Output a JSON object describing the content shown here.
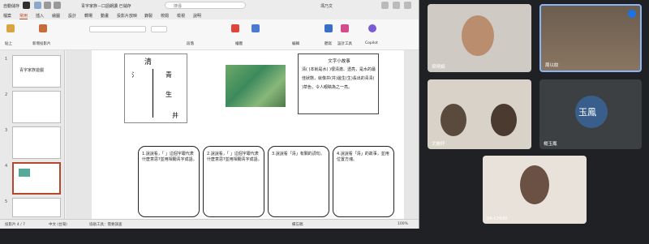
{
  "titlebar": {
    "autosave": "自動儲存",
    "doc_title": "青字家族－口語朗讀 已儲存",
    "search": "搜尋",
    "user": "馮乃文",
    "colors": {
      "brand": "#b7472a"
    }
  },
  "menubar": {
    "items": [
      "檔案",
      "常用",
      "插入",
      "繪圖",
      "設計",
      "轉場",
      "動畫",
      "投影片放映",
      "錄製",
      "校閱",
      "檢視",
      "說明"
    ],
    "selected_index": 1
  },
  "ribbon": {
    "groups": [
      "貼上",
      "新增投影片",
      "段落",
      "繪圖",
      "編輯",
      "聽寫",
      "設計工具",
      "Copilot"
    ]
  },
  "thumbnails": {
    "numbers": [
      "1",
      "2",
      "3",
      "4",
      "5"
    ],
    "slide1_title": "青字家族遊戲",
    "selected_index": 3
  },
  "slide": {
    "story_title": "文字小故事",
    "story_body": "清( )本就是水( )很清澈、透亮，是水的最佳狀態，就像井(井)邊生(生)長出的青青( )草色，令人眼睛為之一亮。",
    "cards": [
      "1.說說看，「 」這個字跟代表什麼意思?並用相關青字成語。",
      "2.說說看，「 」這個字跟代表什麼意思?並用相關青字成語。",
      "3.說說看「清」有關的詞句。",
      "4.說說看「清」的故事，並用位置方塊。"
    ],
    "char_main": "清",
    "char_parts": [
      "氵",
      "青",
      "生",
      "井"
    ]
  },
  "statusbar": {
    "slide_info": "投影片 4 / 7",
    "lang": "中文 (台灣)",
    "accessibility": "協助工具：需要調查",
    "notes": "備忘稿",
    "zoom": "100%"
  },
  "meet": {
    "participants": [
      {
        "name": "梁晴娟"
      },
      {
        "name": "周以紋",
        "pinned": true
      },
      {
        "name": "尤麗妤"
      },
      {
        "name": "楊玉鳳",
        "initials": "玉鳳"
      },
      {
        "name": "JIA-CHUN"
      }
    ]
  }
}
